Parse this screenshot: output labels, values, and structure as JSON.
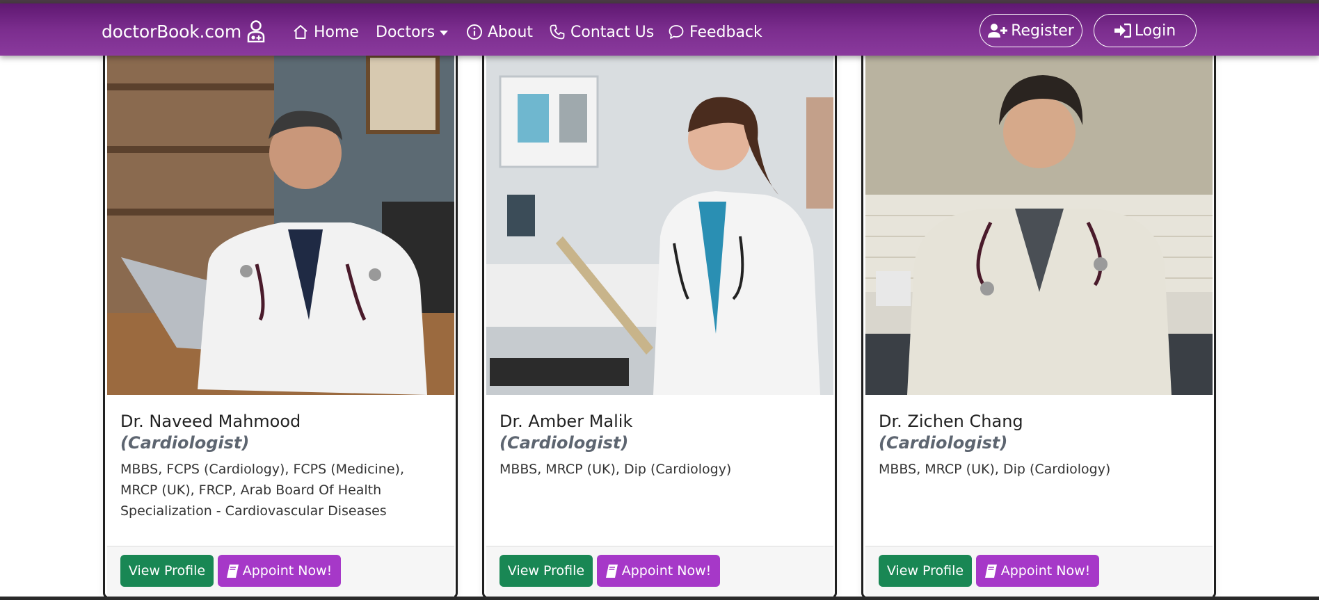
{
  "navbar": {
    "brand": "doctorBook.com",
    "items": [
      {
        "label": "Home",
        "icon": "home-icon"
      },
      {
        "label": "Doctors",
        "icon": "chevron-down-icon"
      },
      {
        "label": "About",
        "icon": "info-icon"
      },
      {
        "label": "Contact Us",
        "icon": "phone-icon"
      },
      {
        "label": "Feedback",
        "icon": "chat-icon"
      }
    ],
    "register_label": "Register",
    "login_label": "Login"
  },
  "doctors": [
    {
      "name": "Dr. Naveed Mahmood",
      "specialty": "(Cardiologist)",
      "qualifications": "MBBS, FCPS (Cardiology), FCPS (Medicine), MRCP (UK), FRCP, Arab Board Of Health Specialization - Cardiovascular Diseases"
    },
    {
      "name": "Dr. Amber Malik",
      "specialty": "(Cardiologist)",
      "qualifications": "MBBS, MRCP (UK), Dip (Cardiology)"
    },
    {
      "name": "Dr. Zichen Chang",
      "specialty": "(Cardiologist)",
      "qualifications": "MBBS, MRCP (UK), Dip (Cardiology)"
    }
  ],
  "buttons": {
    "view_profile": "View Profile",
    "appoint": "Appoint Now!"
  },
  "colors": {
    "navbar": "#7b2d8e",
    "view_profile": "#198754",
    "appoint": "#a638c8",
    "specialty_text": "#5d6570"
  }
}
